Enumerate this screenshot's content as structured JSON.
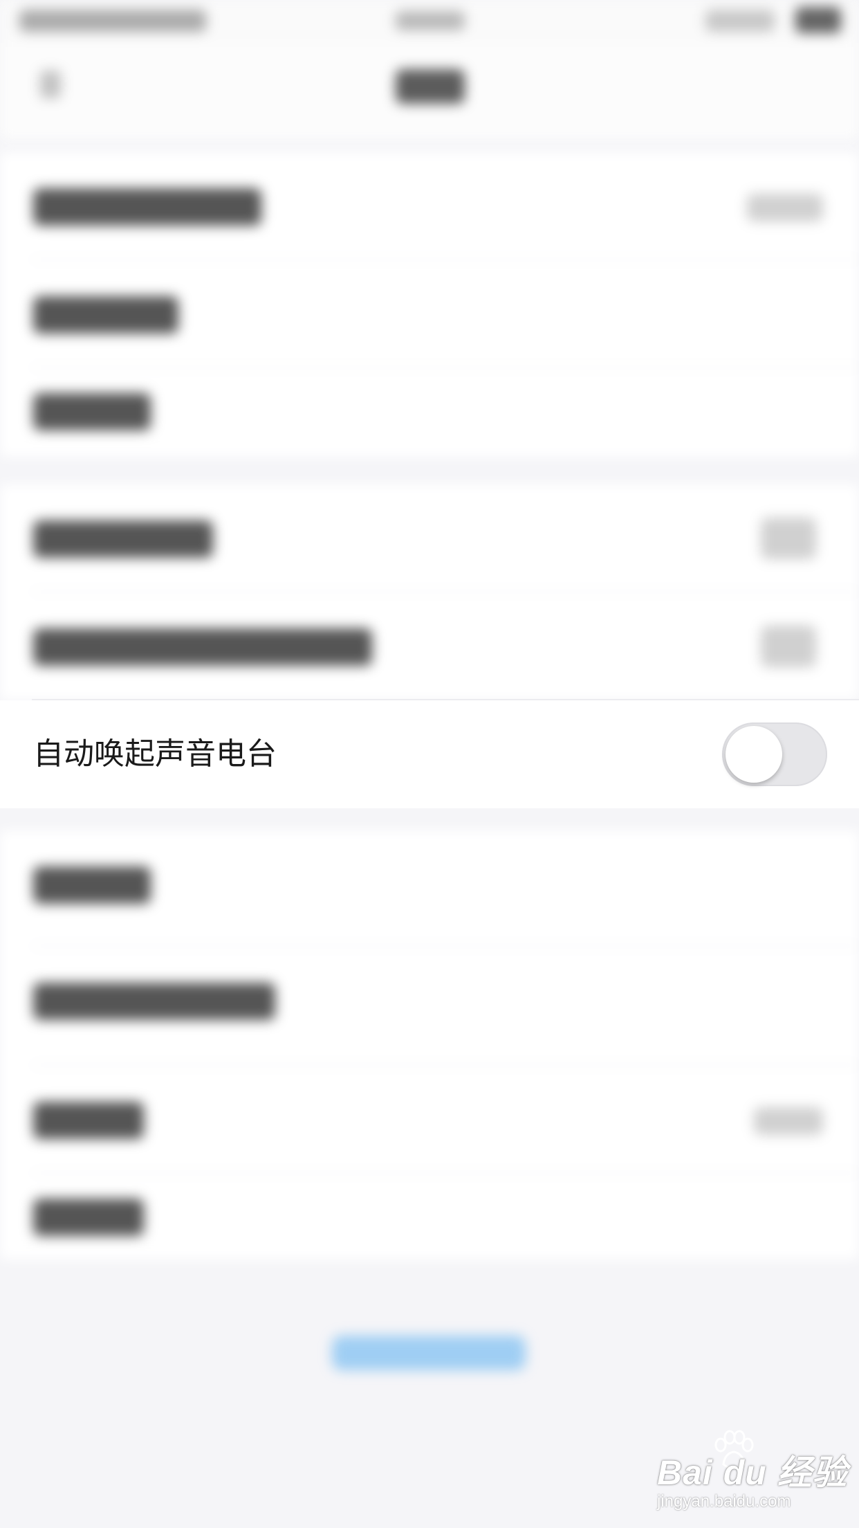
{
  "settings": {
    "highlighted_item": {
      "label": "自动唤起声音电台",
      "toggle_on": false
    }
  },
  "watermark": {
    "brand": "Bai  du 经验",
    "url": "jingyan.baidu.com"
  },
  "colors": {
    "background": "#f5f5f8",
    "row_background": "#ffffff",
    "toggle_off": "#e6e6e9",
    "accent_blue": "#4aa8f0"
  }
}
